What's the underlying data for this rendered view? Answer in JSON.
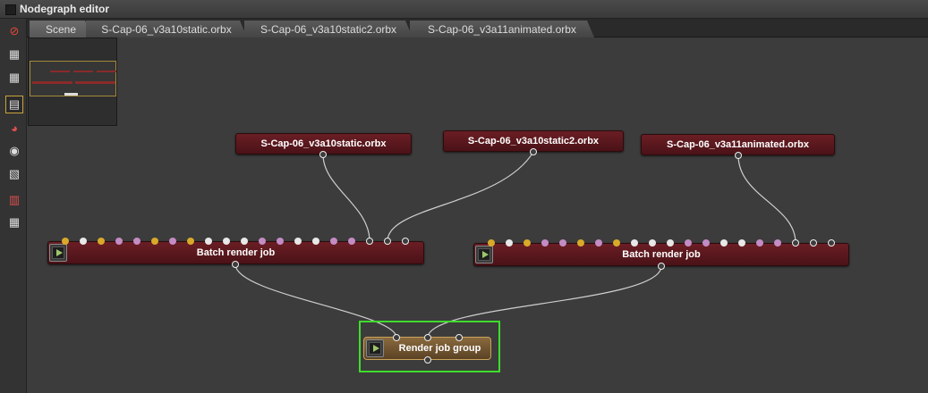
{
  "window": {
    "title": "Nodegraph editor"
  },
  "tabs": [
    {
      "label": "Scene"
    },
    {
      "label": "S-Cap-06_v3a10static.orbx"
    },
    {
      "label": "S-Cap-06_v3a10static2.orbx"
    },
    {
      "label": "S-Cap-06_v3a11animated.orbx"
    }
  ],
  "toolbar": {
    "tools": [
      {
        "name": "no-render-icon",
        "glyph": "⊘"
      },
      {
        "name": "node-graph-icon",
        "glyph": "▦"
      },
      {
        "name": "node-graph-alt-icon",
        "glyph": "▦"
      },
      {
        "name": "render-target-icon",
        "glyph": "▤"
      },
      {
        "name": "material-icon",
        "glyph": "◕"
      },
      {
        "name": "texture-icon",
        "glyph": "◉"
      },
      {
        "name": "camera-icon",
        "glyph": "▧"
      },
      {
        "name": "grid-icon",
        "glyph": "▥"
      },
      {
        "name": "table-icon",
        "glyph": "▦"
      }
    ]
  },
  "nodes": {
    "file1": {
      "label": "S-Cap-06_v3a10static.orbx"
    },
    "file2": {
      "label": "S-Cap-06_v3a10static2.orbx"
    },
    "file3": {
      "label": "S-Cap-06_v3a11animated.orbx"
    },
    "batch1": {
      "label": "Batch render job"
    },
    "batch2": {
      "label": "Batch render job"
    },
    "group": {
      "label": "Render job group"
    }
  },
  "colors": {
    "pin_gold": "#d9a92a",
    "pin_white": "#e8e8e8",
    "pin_pink": "#c48cc4",
    "play_green": "#9ec66b",
    "selection_green": "#3fdc2c",
    "node_red": "#5a171c"
  }
}
